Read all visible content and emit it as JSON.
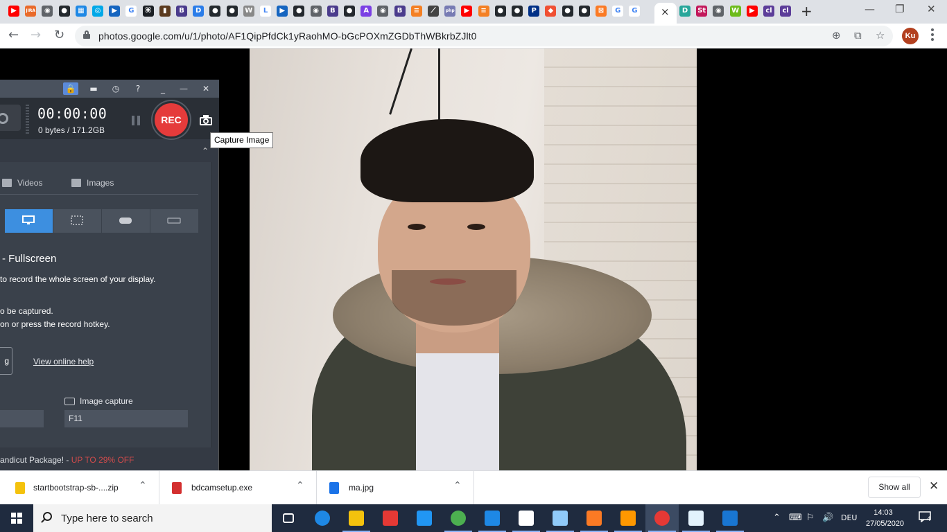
{
  "browser": {
    "favicons": [
      {
        "name": "youtube-icon",
        "color": "#ff0000",
        "glyph": "▶"
      },
      {
        "name": "jira-icon",
        "color": "#e96b2b",
        "glyph": "JIRA"
      },
      {
        "name": "globe-icon",
        "color": "#5f6368",
        "glyph": "◉"
      },
      {
        "name": "github-icon",
        "color": "#24292e",
        "glyph": "●"
      },
      {
        "name": "grid-icon",
        "color": "#1e88e5",
        "glyph": "▦"
      },
      {
        "name": "ring-icon",
        "color": "#00a8e8",
        "glyph": "◎"
      },
      {
        "name": "flag-icon",
        "color": "#1565c0",
        "glyph": "▶"
      },
      {
        "name": "google-icon",
        "color": "#ffffff",
        "glyph": "G"
      },
      {
        "name": "code-icon",
        "color": "#1b1f24",
        "glyph": "⌘"
      },
      {
        "name": "book-icon",
        "color": "#5b3a1e",
        "glyph": "▮"
      },
      {
        "name": "b-icon",
        "color": "#4a3b8c",
        "glyph": "B"
      },
      {
        "name": "d-icon",
        "color": "#2b7de9",
        "glyph": "D"
      },
      {
        "name": "github-icon",
        "color": "#24292e",
        "glyph": "●"
      },
      {
        "name": "github-icon",
        "color": "#24292e",
        "glyph": "●"
      },
      {
        "name": "wordpress-icon",
        "color": "#888888",
        "glyph": "W"
      },
      {
        "name": "l-icon",
        "color": "#ffffff",
        "glyph": "L"
      },
      {
        "name": "flag-icon",
        "color": "#1565c0",
        "glyph": "▶"
      },
      {
        "name": "github-icon",
        "color": "#24292e",
        "glyph": "●"
      },
      {
        "name": "globe-icon",
        "color": "#5f6368",
        "glyph": "◉"
      },
      {
        "name": "b-icon",
        "color": "#4a3b8c",
        "glyph": "B"
      },
      {
        "name": "github-icon",
        "color": "#24292e",
        "glyph": "●"
      },
      {
        "name": "a-icon",
        "color": "#7b3fe4",
        "glyph": "A"
      },
      {
        "name": "globe-icon",
        "color": "#5f6368",
        "glyph": "◉"
      },
      {
        "name": "b-icon",
        "color": "#4a3b8c",
        "glyph": "B"
      },
      {
        "name": "stack-icon",
        "color": "#f48024",
        "glyph": "≡"
      },
      {
        "name": "link-icon",
        "color": "#444444",
        "glyph": "⟋"
      },
      {
        "name": "php-icon",
        "color": "#777bb3",
        "glyph": "php"
      },
      {
        "name": "youtube-icon",
        "color": "#ff0000",
        "glyph": "▶"
      },
      {
        "name": "stack-icon",
        "color": "#f48024",
        "glyph": "≡"
      },
      {
        "name": "github-icon",
        "color": "#24292e",
        "glyph": "●"
      },
      {
        "name": "github-icon",
        "color": "#24292e",
        "glyph": "●"
      },
      {
        "name": "paypal-icon",
        "color": "#003087",
        "glyph": "P"
      },
      {
        "name": "git-icon",
        "color": "#f05033",
        "glyph": "◆"
      },
      {
        "name": "github-icon",
        "color": "#24292e",
        "glyph": "●"
      },
      {
        "name": "github-icon",
        "color": "#24292e",
        "glyph": "●"
      },
      {
        "name": "xampp-icon",
        "color": "#fb7a24",
        "glyph": "⊠"
      },
      {
        "name": "google-icon",
        "color": "#ffffff",
        "glyph": "G"
      },
      {
        "name": "google-icon",
        "color": "#ffffff",
        "glyph": "G"
      }
    ],
    "favicons_right": [
      {
        "name": "d-icon",
        "color": "#27a69a",
        "glyph": "D"
      },
      {
        "name": "st-icon",
        "color": "#c2185b",
        "glyph": "St"
      },
      {
        "name": "globe-icon",
        "color": "#5f6368",
        "glyph": "◉"
      },
      {
        "name": "w-icon",
        "color": "#6dbb1a",
        "glyph": "W"
      },
      {
        "name": "youtube-icon",
        "color": "#ff0000",
        "glyph": "▶"
      },
      {
        "name": "colorlib-icon",
        "color": "#5c3d99",
        "glyph": "cl"
      },
      {
        "name": "colorlib-icon",
        "color": "#5c3d99",
        "glyph": "cl"
      }
    ],
    "active_tab_close": "×",
    "new_tab": "+",
    "window_buttons": [
      "—",
      "❐",
      "✕"
    ],
    "url": "photos.google.com/u/1/photo/AF1QipPfdCk1yRaohMO-bGcPOXmZGDbThWBkrbZJlt0",
    "profile_initials": "Ku"
  },
  "bandicam": {
    "timer": "00:00:00",
    "size": "0 bytes / 171.2GB",
    "rec_label": "REC",
    "tabs": [
      "Videos",
      "Images"
    ],
    "mode_heading": "- Fullscreen",
    "lines": [
      "to record the whole screen of your display.",
      "o be captured.",
      "on or press the record hotkey."
    ],
    "button_edge_text": "g",
    "help_link": "View online help",
    "image_capture_label": "Image capture",
    "hotkey_value": "F11",
    "promo_prefix": "andicut Package! - ",
    "promo_highlight": "UP TO 29% OFF",
    "collapse_glyph": "⌃",
    "titlebar_glyphs": [
      "🔒",
      "▬",
      "◷",
      "?",
      "_",
      "—",
      "✕"
    ]
  },
  "tooltip": "Capture Image",
  "downloads": [
    {
      "name": "startbootstrap-sb-....zip",
      "icon_color": "#f4c20d"
    },
    {
      "name": "bdcamsetup.exe",
      "icon_color": "#d32f2f"
    },
    {
      "name": "ma.jpg",
      "icon_color": "#1a73e8"
    }
  ],
  "download_chevron": "⌃",
  "show_all": "Show all",
  "shelf_close": "✕",
  "taskbar": {
    "search_placeholder": "Type here to search",
    "apps": [
      {
        "name": "task-view-icon",
        "color": "#ffffff"
      },
      {
        "name": "edge-icon",
        "color": "#1e88e5"
      },
      {
        "name": "file-explorer-icon",
        "color": "#f4c20d"
      },
      {
        "name": "store-icon",
        "color": "#e53935"
      },
      {
        "name": "mail-icon",
        "color": "#2196f3"
      },
      {
        "name": "chrome-icon",
        "color": "#4caf50"
      },
      {
        "name": "vscode-icon",
        "color": "#1e88e5"
      },
      {
        "name": "app-icon",
        "color": "#ffffff"
      },
      {
        "name": "paint-icon",
        "color": "#90caf9"
      },
      {
        "name": "xampp-icon",
        "color": "#fb7a24"
      },
      {
        "name": "sublime-icon",
        "color": "#ff9800"
      },
      {
        "name": "bandicam-icon",
        "color": "#e53935"
      },
      {
        "name": "notepad-icon",
        "color": "#e3f2fd"
      },
      {
        "name": "photos-icon",
        "color": "#1976d2"
      }
    ],
    "tray_icons": [
      "⌃",
      "⌨",
      "⚐",
      "🔊"
    ],
    "language": "DEU",
    "time": "14:03",
    "date": "27/05/2020",
    "notifications": "4"
  }
}
